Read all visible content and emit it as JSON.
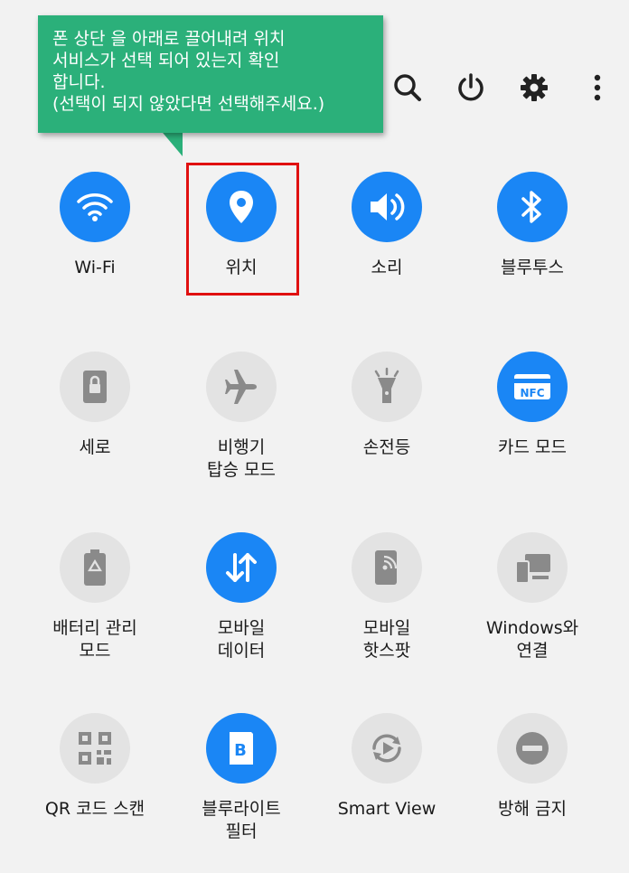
{
  "callout": {
    "lines": [
      "폰 상단 을 아래로 끌어내려 위치",
      "서비스가 선택 되어 있는지 확인",
      "합니다.",
      "(선택이 되지 않았다면 선택해주세요.)"
    ],
    "color": "#2bb07a"
  },
  "top_icons": [
    "search-icon",
    "power-icon",
    "gear-icon",
    "more-vertical-icon"
  ],
  "colors": {
    "active": "#1a86f5",
    "inactive": "#e3e3e3",
    "highlight": "#e01010",
    "background": "#f2f2f2"
  },
  "tiles": [
    {
      "label": "Wi-Fi",
      "icon": "wifi-icon",
      "active": true
    },
    {
      "label": "위치",
      "icon": "location-pin-icon",
      "active": true
    },
    {
      "label": "소리",
      "icon": "volume-icon",
      "active": true
    },
    {
      "label": "블루투스",
      "icon": "bluetooth-icon",
      "active": true
    },
    {
      "label": "세로",
      "icon": "rotation-lock-icon",
      "active": false
    },
    {
      "label": "비행기\n탑승 모드",
      "icon": "airplane-icon",
      "active": false
    },
    {
      "label": "손전등",
      "icon": "flashlight-icon",
      "active": false
    },
    {
      "label": "카드 모드",
      "icon": "nfc-icon",
      "active": true,
      "icon_text": "NFC"
    },
    {
      "label": "배터리 관리\n모드",
      "icon": "battery-recycle-icon",
      "active": false
    },
    {
      "label": "모바일\n데이터",
      "icon": "mobile-data-icon",
      "active": true
    },
    {
      "label": "모바일\n핫스팟",
      "icon": "hotspot-icon",
      "active": false
    },
    {
      "label": "Windows와\n연결",
      "icon": "link-to-windows-icon",
      "active": false
    },
    {
      "label": "QR 코드 스캔",
      "icon": "qr-code-icon",
      "active": false
    },
    {
      "label": "블루라이트\n필터",
      "icon": "blue-light-filter-icon",
      "active": true,
      "icon_text": "B"
    },
    {
      "label": "Smart View",
      "icon": "smart-view-icon",
      "active": false
    },
    {
      "label": "방해 금지",
      "icon": "do-not-disturb-icon",
      "active": false
    }
  ]
}
